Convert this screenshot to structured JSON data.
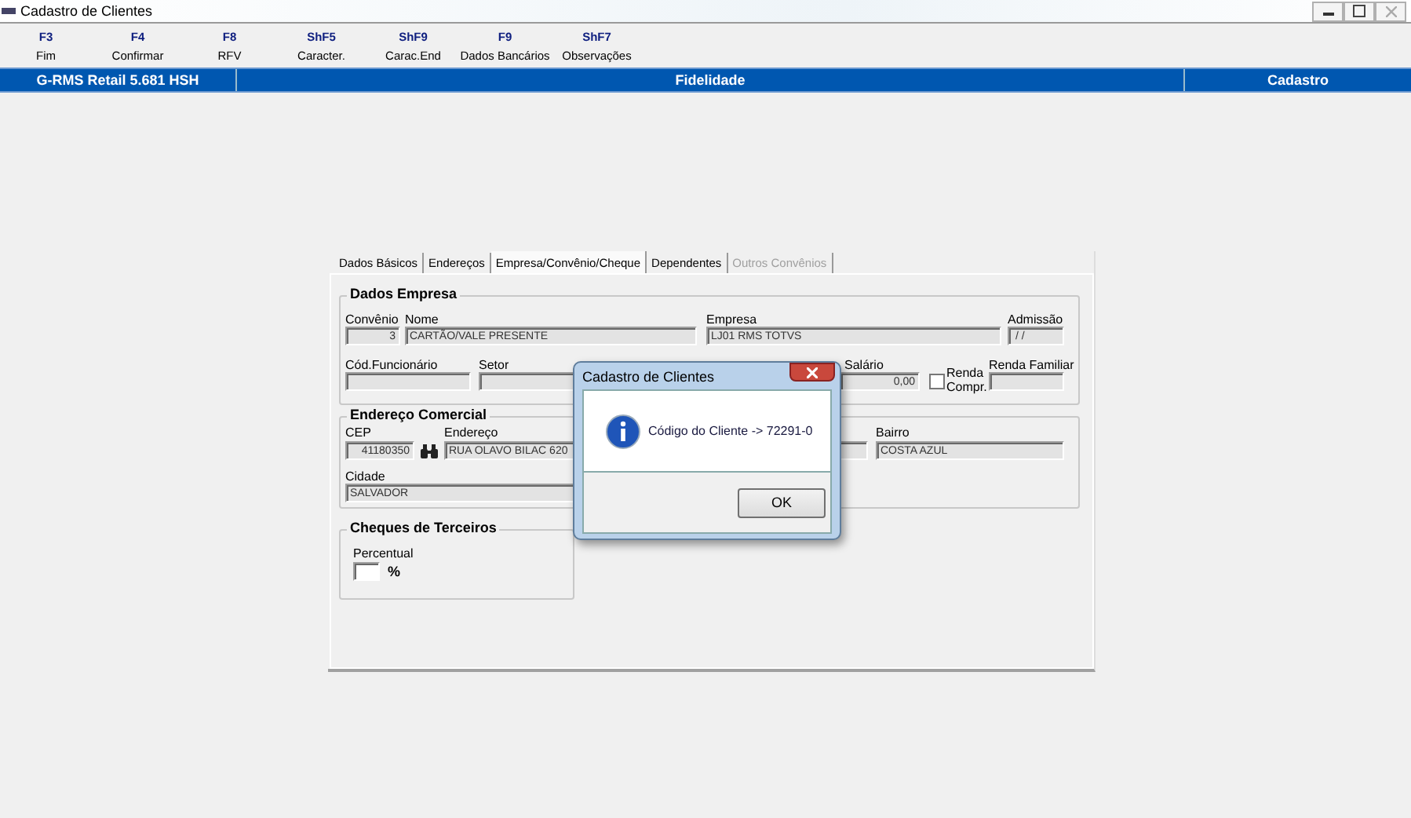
{
  "window": {
    "title": "Cadastro de Clientes"
  },
  "toolbar": [
    {
      "key": "F3",
      "label": "Fim"
    },
    {
      "key": "F4",
      "label": "Confirmar"
    },
    {
      "key": "F8",
      "label": "RFV"
    },
    {
      "key": "ShF5",
      "label": "Caracter."
    },
    {
      "key": "ShF9",
      "label": "Carac.End"
    },
    {
      "key": "F9",
      "label": "Dados Bancários"
    },
    {
      "key": "ShF7",
      "label": "Observações"
    }
  ],
  "header_bar": [
    "G-RMS Retail 5.681 HSH",
    "Fidelidade",
    "Cadastro"
  ],
  "tabs": [
    {
      "label": "Dados Básicos",
      "selected": false,
      "disabled": false
    },
    {
      "label": "Endereços",
      "selected": false,
      "disabled": false
    },
    {
      "label": "Empresa/Convênio/Cheque",
      "selected": true,
      "disabled": false
    },
    {
      "label": "Dependentes",
      "selected": false,
      "disabled": false
    },
    {
      "label": "Outros Convênios",
      "selected": false,
      "disabled": true
    }
  ],
  "dados_empresa": {
    "title": "Dados Empresa",
    "convenio_label": "Convênio",
    "convenio": "3",
    "nome_label": "Nome",
    "nome": "CARTÃO/VALE PRESENTE",
    "empresa_label": "Empresa",
    "empresa": "LJ01 RMS TOTVS",
    "admissao_label": "Admissão",
    "admissao": " / /",
    "cod_funcionario_label": "Cód.Funcionário",
    "setor_label": "Setor",
    "salario_label": "Salário",
    "salario": "0,00",
    "renda_compr": {
      "label": "Renda Compr.",
      "checked": false
    },
    "renda_familiar_label": "Renda Familiar"
  },
  "endereco_comercial": {
    "title": "Endereço Comercial",
    "cep_label": "CEP",
    "cep": "41180350",
    "endereco_label": "Endereço",
    "endereco": "RUA OLAVO BILAC 620",
    "bairro_label": "Bairro",
    "bairro": "COSTA AZUL",
    "cidade_label": "Cidade",
    "cidade": "SALVADOR"
  },
  "cheques_terceiros": {
    "title": "Cheques de Terceiros",
    "percentual_label": "Percentual",
    "percent_sign": "%"
  },
  "dialog": {
    "title": "Cadastro de Clientes",
    "message": "Código do Cliente -> 72291-0",
    "button": "OK"
  }
}
